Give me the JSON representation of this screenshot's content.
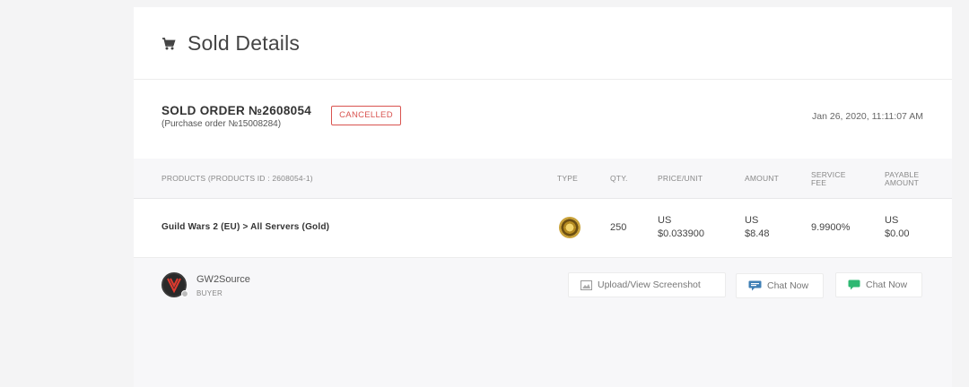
{
  "header": {
    "title": "Sold Details",
    "icon": "cart-icon"
  },
  "order": {
    "number": "SOLD ORDER №2608054",
    "purchase_order": "(Purchase order №15008284)",
    "status": "CANCELLED",
    "status_color": "#d9534f",
    "date": "Jan 26, 2020, 11:11:07 AM"
  },
  "table": {
    "headers": {
      "products": "PRODUCTS (PRODUCTS ID : 2608054-1)",
      "type": "TYPE",
      "qty": "QTY.",
      "price_unit": "PRICE/UNIT",
      "amount": "AMOUNT",
      "service_fee_1": "SERVICE",
      "service_fee_2": "FEE",
      "payable_1": "PAYABLE",
      "payable_2": "AMOUNT"
    },
    "row": {
      "product": "Guild Wars 2 (EU) > All Servers (Gold)",
      "type_icon": "gold-coin-icon",
      "qty": "250",
      "price_currency": "US",
      "price_value": "$0.033900",
      "amount_currency": "US",
      "amount_value": "$8.48",
      "service_fee": "9.9900%",
      "payable_currency": "US",
      "payable_value": "$0.00"
    }
  },
  "buyer": {
    "name": "GW2Source",
    "role": "BUYER",
    "status_dot_color": "#bbbbbb"
  },
  "actions": {
    "upload_label": "Upload/View Screenshot",
    "chat1_label": "Chat Now",
    "chat2_label": "Chat Now"
  }
}
